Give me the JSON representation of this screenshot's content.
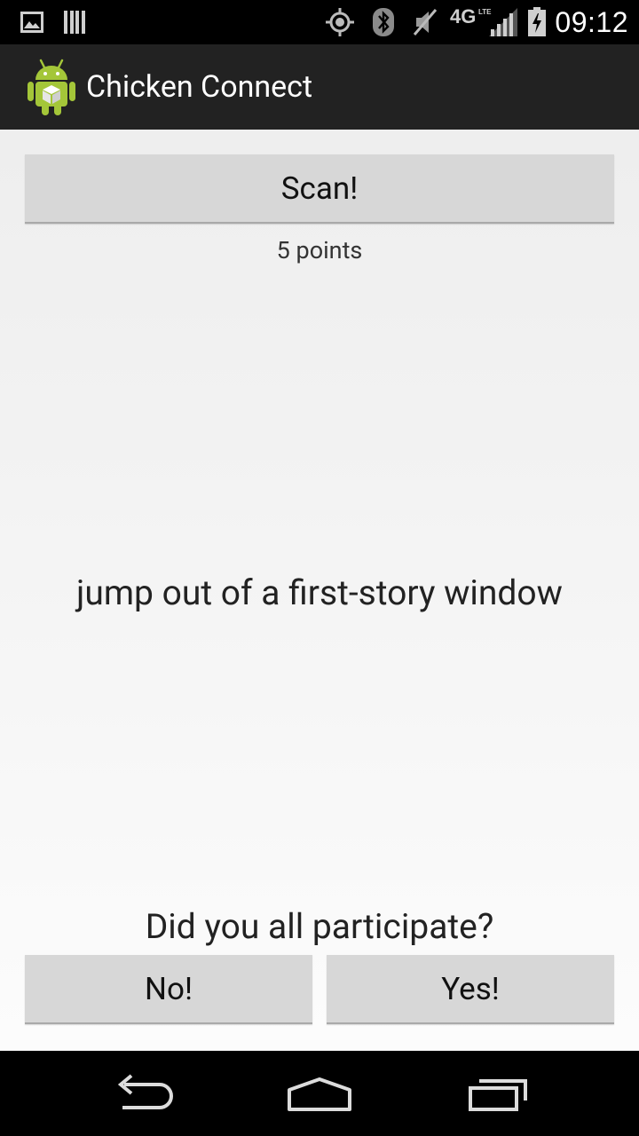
{
  "status_bar": {
    "time": "09:12",
    "icons": [
      "picture-icon",
      "barcode-icon",
      "gps-icon",
      "bluetooth-icon",
      "mute-icon",
      "4g-lte-icon",
      "signal-icon",
      "battery-charging-icon"
    ]
  },
  "action_bar": {
    "title": "Chicken Connect",
    "app_icon": "android-app-icon"
  },
  "main": {
    "scan_label": "Scan!",
    "points_text": "5 points",
    "challenge_text": "jump out of a first-story window",
    "question_text": "Did you all participate?",
    "no_label": "No!",
    "yes_label": "Yes!"
  },
  "nav_bar": {
    "icons": [
      "back-icon",
      "home-icon",
      "recent-apps-icon"
    ]
  },
  "colors": {
    "action_bar_bg": "#222222",
    "button_bg": "#d7d7d7",
    "android_green": "#a4c639"
  }
}
